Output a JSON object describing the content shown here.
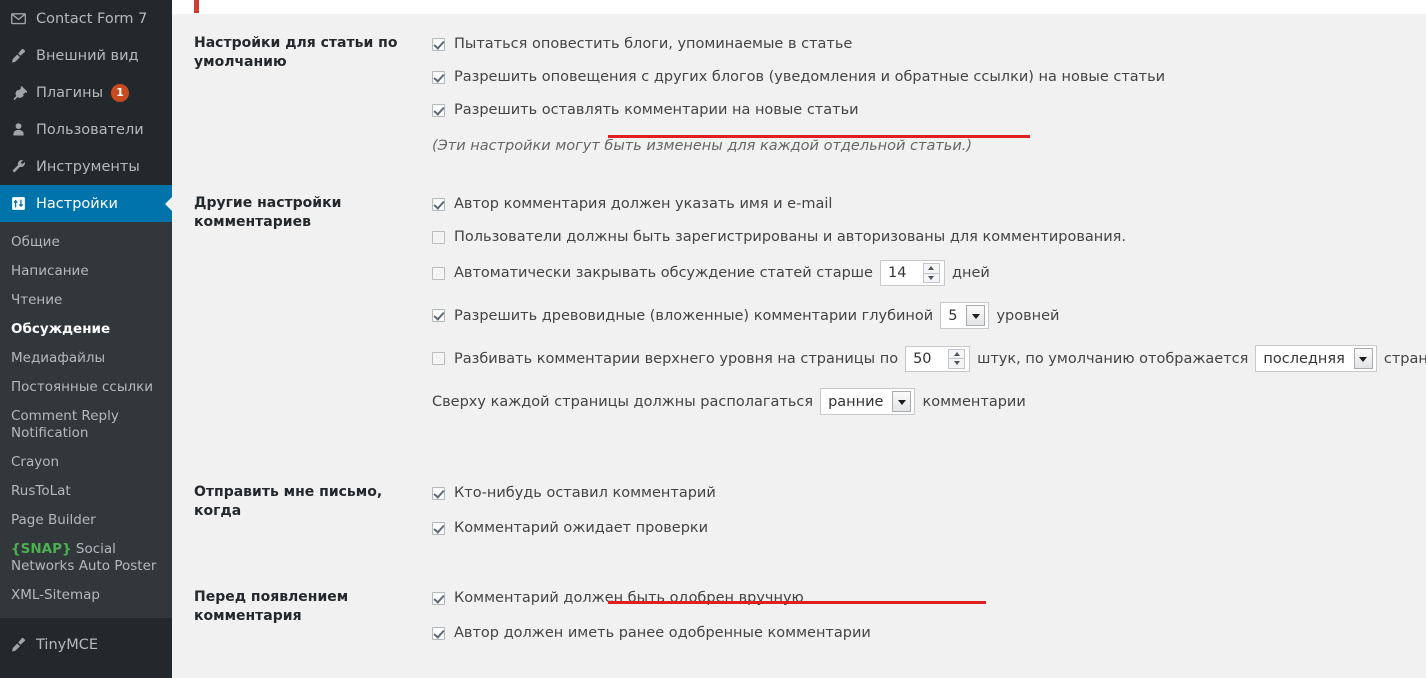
{
  "sidebar": {
    "top_items": [
      {
        "label": "Contact Form 7",
        "icon": "envelope-icon",
        "badge": null,
        "active": false
      },
      {
        "label": "Внешний вид",
        "icon": "paintbrush-icon",
        "badge": null,
        "active": false
      },
      {
        "label": "Плагины",
        "icon": "plug-icon",
        "badge": "1",
        "active": false
      },
      {
        "label": "Пользователи",
        "icon": "user-icon",
        "badge": null,
        "active": false
      },
      {
        "label": "Инструменты",
        "icon": "wrench-icon",
        "badge": null,
        "active": false
      },
      {
        "label": "Настройки",
        "icon": "settings-sliders-icon",
        "badge": null,
        "active": true
      }
    ],
    "submenu": [
      {
        "label": "Общие",
        "current": false
      },
      {
        "label": "Написание",
        "current": false
      },
      {
        "label": "Чтение",
        "current": false
      },
      {
        "label": "Обсуждение",
        "current": true
      },
      {
        "label": "Медиафайлы",
        "current": false
      },
      {
        "label": "Постоянные ссылки",
        "current": false
      },
      {
        "label": "Comment Reply Notification",
        "current": false
      },
      {
        "label": "Crayon",
        "current": false
      },
      {
        "label": "RusToLat",
        "current": false
      },
      {
        "label": "Page Builder",
        "current": false
      },
      {
        "label": "{SNAP} Social Networks Auto Poster",
        "current": false,
        "prefix": "{SNAP}",
        "rest": " Social Networks Auto Poster"
      },
      {
        "label": "XML-Sitemap",
        "current": false
      }
    ],
    "bottom_items": [
      {
        "label": "TinyMCE",
        "icon": "pencil-icon",
        "badge": null,
        "active": false
      }
    ],
    "accent_color": "#0073aa",
    "badge_color": "#ca4a1f",
    "snap_color": "#4caf50"
  },
  "sections": {
    "default_post": {
      "heading": "Настройки для статьи по умолчанию",
      "options": [
        {
          "label": "Пытаться оповестить блоги, упоминаемые в статье",
          "checked": true,
          "highlighted": false
        },
        {
          "label": "Разрешить оповещения с других блогов (уведомления и обратные ссылки) на новые статьи",
          "checked": true,
          "highlighted": false
        },
        {
          "label": "Разрешить оставлять комментарии на новые статьи",
          "checked": true,
          "highlighted": true
        }
      ],
      "hint": "(Эти настройки могут быть изменены для каждой отдельной статьи.)"
    },
    "other_comments": {
      "heading": "Другие настройки комментариев",
      "opt_author_name_email": {
        "label": "Автор комментария должен указать имя и e-mail",
        "checked": true
      },
      "opt_registered_users": {
        "label": "Пользователи должны быть зарегистрированы и авторизованы для комментирования.",
        "checked": false
      },
      "opt_auto_close": {
        "label_before": "Автоматически закрывать обсуждение статей старше",
        "value": "14",
        "label_after": "дней",
        "checked": false
      },
      "opt_threaded": {
        "label_before": "Разрешить древовидные (вложенные) комментарии глубиной",
        "value": "5",
        "label_after": "уровней",
        "checked": true
      },
      "opt_paging": {
        "label_before": "Разбивать комментарии верхнего уровня на страницы по",
        "value": "50",
        "label_mid": "штук, по умолчанию отображается",
        "select_value": "последняя",
        "label_after": "страница",
        "checked": false
      },
      "opt_order": {
        "label_before": "Сверху каждой страницы должны располагаться",
        "select_value": "ранние",
        "label_after": "комментарии"
      }
    },
    "email_me": {
      "heading": "Отправить мне письмо, когда",
      "options": [
        {
          "label": "Кто-нибудь оставил комментарий",
          "checked": true,
          "highlighted": false
        },
        {
          "label": "Комментарий ожидает проверки",
          "checked": true,
          "highlighted": false
        }
      ]
    },
    "before_comment": {
      "heading": "Перед появлением комментария",
      "options": [
        {
          "label": "Комментарий должен быть одобрен вручную",
          "checked": true,
          "highlighted": true
        },
        {
          "label": "Автор должен иметь ранее одобренные комментарии",
          "checked": true,
          "highlighted": false
        }
      ]
    }
  },
  "annotations": {
    "color": "#e02020",
    "underline_count": 2
  }
}
